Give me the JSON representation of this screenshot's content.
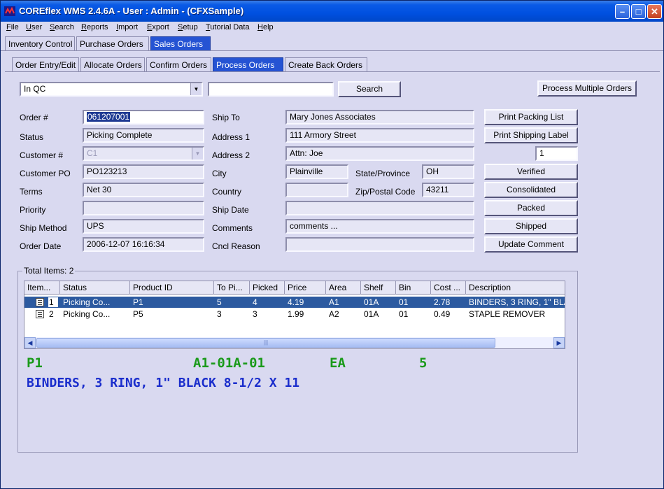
{
  "window": {
    "title": "COREflex WMS 2.4.6A - User : Admin - (CFXSample)"
  },
  "menu": [
    {
      "label": "File",
      "key": "F",
      "rest": "ile"
    },
    {
      "label": "User",
      "key": "U",
      "rest": "ser"
    },
    {
      "label": "Search",
      "key": "S",
      "rest": "earch"
    },
    {
      "label": "Reports",
      "key": "R",
      "rest": "eports"
    },
    {
      "label": "Import",
      "key": "I",
      "rest": "mport"
    },
    {
      "label": "Export",
      "key": "E",
      "rest": "xport"
    },
    {
      "label": "Setup",
      "key": "S",
      "rest": "etup"
    },
    {
      "label": "Tutorial Data",
      "key": "T",
      "rest": "utorial Data"
    },
    {
      "label": "Help",
      "key": "H",
      "rest": "elp"
    }
  ],
  "main_tabs": [
    "Inventory Control",
    "Purchase Orders",
    "Sales Orders"
  ],
  "sub_tabs": [
    "Order Entry/Edit",
    "Allocate Orders",
    "Confirm Orders",
    "Process Orders",
    "Create Back Orders"
  ],
  "filter": {
    "status_value": "In QC",
    "search_value": "",
    "search_label": "Search",
    "process_multiple_label": "Process Multiple Orders"
  },
  "order": {
    "order_no_label": "Order #",
    "order_no": "061207001",
    "status_label": "Status",
    "status": "Picking Complete",
    "customer_label": "Customer #",
    "customer": "C1",
    "customer_po_label": "Customer PO",
    "customer_po": "PO123213",
    "terms_label": "Terms",
    "terms": "Net 30",
    "priority_label": "Priority",
    "priority": "",
    "ship_method_label": "Ship Method",
    "ship_method": "UPS",
    "order_date_label": "Order Date",
    "order_date": "2006-12-07 16:16:34"
  },
  "ship": {
    "ship_to_label": "Ship To",
    "ship_to": "Mary Jones Associates",
    "address1_label": "Address 1",
    "address1": "111 Armory Street",
    "address2_label": "Address 2",
    "address2": "Attn: Joe",
    "city_label": "City",
    "city": "Plainville",
    "state_label": "State/Province",
    "state": "OH",
    "country_label": "Country",
    "country": "",
    "zip_label": "Zip/Postal Code",
    "zip": "43211",
    "ship_date_label": "Ship Date",
    "ship_date": "",
    "comments_label": "Comments",
    "comments": "comments ...",
    "cncl_label": "Cncl Reason",
    "cncl": ""
  },
  "actions": {
    "print_packing": "Print Packing List",
    "print_shipping": "Print Shipping Label",
    "label_count": "1",
    "verified": "Verified",
    "consolidated": "Consolidated",
    "packed": "Packed",
    "shipped": "Shipped",
    "update_comment": "Update Comment"
  },
  "items": {
    "total_label": "Total Items: 2",
    "columns": [
      "Item...",
      "Status",
      "Product ID",
      "To Pi...",
      "Picked",
      "Price",
      "Area",
      "Shelf",
      "Bin",
      "Cost ...",
      "Description"
    ],
    "rows": [
      {
        "item": "1",
        "status": "Picking Co...",
        "product": "P1",
        "to_pick": "5",
        "picked": "4",
        "price": "4.19",
        "area": "A1",
        "shelf": "01A",
        "bin": "01",
        "cost": "2.78",
        "desc": "BINDERS, 3 RING, 1\" BLA"
      },
      {
        "item": "2",
        "status": "Picking Co...",
        "product": "P5",
        "to_pick": "3",
        "picked": "3",
        "price": "1.99",
        "area": "A2",
        "shelf": "01A",
        "bin": "01",
        "cost": "0.49",
        "desc": "STAPLE REMOVER"
      }
    ]
  },
  "detail": {
    "product": "P1",
    "location": "A1-01A-01",
    "unit": "EA",
    "qty": "5",
    "description": "BINDERS, 3 RING, 1\" BLACK 8-1/2 X 11",
    "green": "#1a9a1a",
    "blue": "#1a2dcc"
  }
}
